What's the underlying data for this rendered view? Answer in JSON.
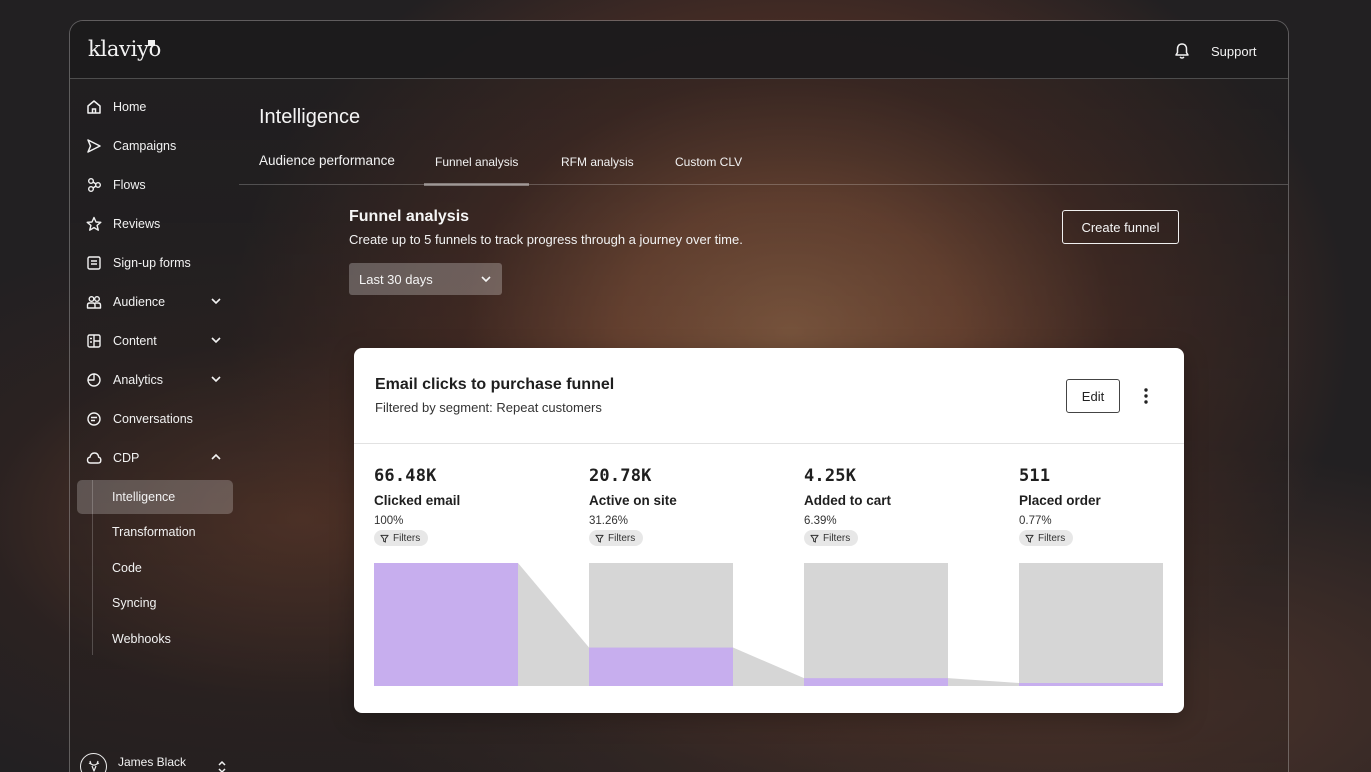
{
  "app": {
    "logo": "klaviyo"
  },
  "topbar": {
    "support_label": "Support"
  },
  "sidebar": {
    "items": [
      {
        "label": "Home",
        "icon": "home-icon"
      },
      {
        "label": "Campaigns",
        "icon": "send-icon"
      },
      {
        "label": "Flows",
        "icon": "flows-icon"
      },
      {
        "label": "Reviews",
        "icon": "star-icon"
      },
      {
        "label": "Sign-up forms",
        "icon": "form-icon"
      },
      {
        "label": "Audience",
        "icon": "people-icon",
        "expandable": true
      },
      {
        "label": "Content",
        "icon": "content-icon",
        "expandable": true
      },
      {
        "label": "Analytics",
        "icon": "analytics-icon",
        "expandable": true
      },
      {
        "label": "Conversations",
        "icon": "chat-icon"
      },
      {
        "label": "CDP",
        "icon": "cloud-icon",
        "expanded": true
      }
    ],
    "cdp_sub": [
      {
        "label": "Intelligence",
        "active": true
      },
      {
        "label": "Transformation"
      },
      {
        "label": "Code"
      },
      {
        "label": "Syncing"
      },
      {
        "label": "Webhooks"
      }
    ],
    "user": {
      "name": "James Black"
    }
  },
  "main": {
    "title": "Intelligence",
    "tabs": [
      {
        "label": "Audience performance"
      },
      {
        "label": "Funnel analysis",
        "active": true
      },
      {
        "label": "RFM analysis"
      },
      {
        "label": "Custom CLV"
      }
    ],
    "section_title": "Funnel analysis",
    "section_desc": "Create up to 5 funnels to track progress through a journey over time.",
    "create_button": "Create funnel",
    "date_range": "Last 30 days"
  },
  "card": {
    "title": "Email clicks to purchase funnel",
    "subtitle": "Filtered by segment: Repeat customers",
    "edit_label": "Edit",
    "filters_label": "Filters",
    "steps": [
      {
        "count": "66.48K",
        "label": "Clicked email",
        "pct": "100%",
        "fraction": 1.0
      },
      {
        "count": "20.78K",
        "label": "Active on site",
        "pct": "31.26%",
        "fraction": 0.3126
      },
      {
        "count": "4.25K",
        "label": "Added to cart",
        "pct": "6.39%",
        "fraction": 0.0639
      },
      {
        "count": "511",
        "label": "Placed order",
        "pct": "0.77%",
        "fraction": 0.0077
      }
    ]
  },
  "colors": {
    "bar_fill": "#c7aeee",
    "bar_track": "#d6d6d6",
    "connector": "#d6d6d6"
  }
}
